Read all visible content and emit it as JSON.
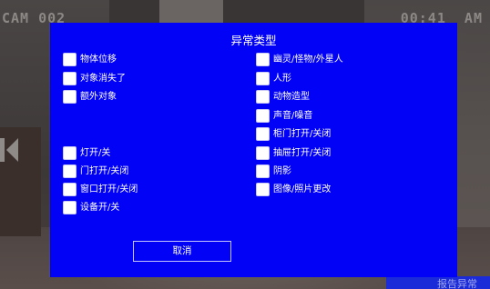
{
  "camera": {
    "label": "CAM 002",
    "time": "00:41  AM"
  },
  "dialog": {
    "title": "异常类型",
    "left_options": [
      {
        "label": "物体位移",
        "checked": false
      },
      {
        "label": "对象消失了",
        "checked": false
      },
      {
        "label": "额外对象",
        "checked": false
      },
      {
        "label": "灯开/关",
        "checked": false
      },
      {
        "label": "门打开/关闭",
        "checked": false
      },
      {
        "label": "窗口打开/关闭",
        "checked": false
      },
      {
        "label": "设备开/关",
        "checked": false
      }
    ],
    "right_options": [
      {
        "label": "幽灵/怪物/外星人",
        "checked": false
      },
      {
        "label": "人形",
        "checked": false
      },
      {
        "label": "动物造型",
        "checked": false
      },
      {
        "label": "声音/噪音",
        "checked": false
      },
      {
        "label": "柜门打开/关闭",
        "checked": false
      },
      {
        "label": "抽屉打开/关闭",
        "checked": false
      },
      {
        "label": "阴影",
        "checked": false
      },
      {
        "label": "图像/照片更改",
        "checked": false
      }
    ],
    "cancel_label": "取消"
  },
  "report_tab": {
    "label": "报告异常"
  },
  "colors": {
    "dialog_bg": "#0202f6",
    "overlay_text": "#8c8886",
    "checkbox": "#ffffff",
    "report_tab_bg": "#1b2bd8"
  },
  "icons": {
    "prev_camera": "chevron-left-icon"
  }
}
